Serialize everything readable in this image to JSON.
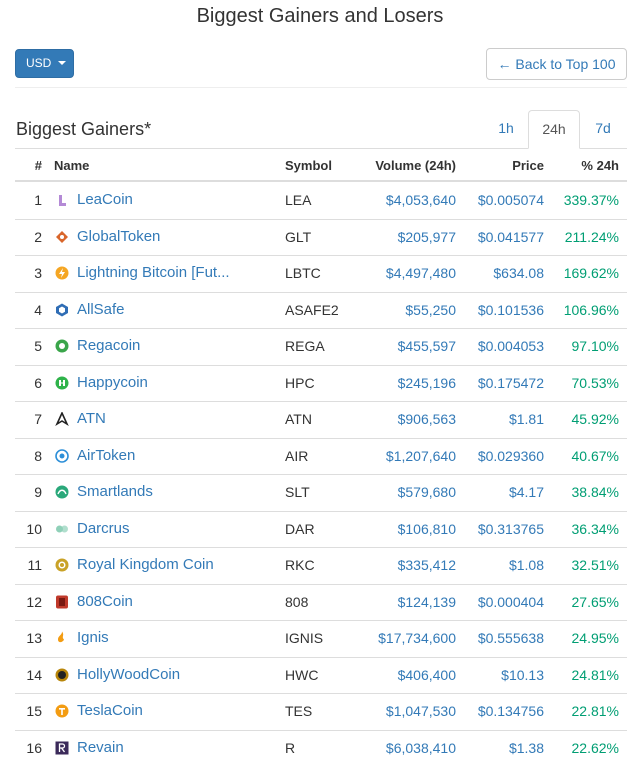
{
  "page": {
    "title": "Biggest Gainers and Losers"
  },
  "toolbar": {
    "currency_label": "USD",
    "back_label": "← Back to Top 100"
  },
  "section": {
    "title": "Biggest Gainers*"
  },
  "tabs": [
    {
      "label": "1h"
    },
    {
      "label": "24h",
      "active": true
    },
    {
      "label": "7d"
    }
  ],
  "table": {
    "headers": {
      "rank": "#",
      "name": "Name",
      "symbol": "Symbol",
      "volume": "Volume (24h)",
      "price": "Price",
      "change": "% 24h"
    },
    "rows": [
      {
        "rank": "1",
        "name": "LeaCoin",
        "symbol": "LEA",
        "volume": "$4,053,640",
        "price": "$0.005074",
        "change": "339.37%",
        "icon": "leacoin-icon",
        "color": "#b48ad6"
      },
      {
        "rank": "2",
        "name": "GlobalToken",
        "symbol": "GLT",
        "volume": "$205,977",
        "price": "$0.041577",
        "change": "211.24%",
        "icon": "globaltoken-icon",
        "color": "#d9662b"
      },
      {
        "rank": "3",
        "name": "Lightning Bitcoin [Fut...",
        "symbol": "LBTC",
        "volume": "$4,497,480",
        "price": "$634.08",
        "change": "169.62%",
        "icon": "lightning-bitcoin-icon",
        "color": "#f5a623"
      },
      {
        "rank": "4",
        "name": "AllSafe",
        "symbol": "ASAFE2",
        "volume": "$55,250",
        "price": "$0.101536",
        "change": "106.96%",
        "icon": "allsafe-icon",
        "color": "#2f6db5"
      },
      {
        "rank": "5",
        "name": "Regacoin",
        "symbol": "REGA",
        "volume": "$455,597",
        "price": "$0.004053",
        "change": "97.10%",
        "icon": "regacoin-icon",
        "color": "#3aa54a"
      },
      {
        "rank": "6",
        "name": "Happycoin",
        "symbol": "HPC",
        "volume": "$245,196",
        "price": "$0.175472",
        "change": "70.53%",
        "icon": "happycoin-icon",
        "color": "#2fb34a"
      },
      {
        "rank": "7",
        "name": "ATN",
        "symbol": "ATN",
        "volume": "$906,563",
        "price": "$1.81",
        "change": "45.92%",
        "icon": "atn-icon",
        "color": "#222222"
      },
      {
        "rank": "8",
        "name": "AirToken",
        "symbol": "AIR",
        "volume": "$1,207,640",
        "price": "$0.029360",
        "change": "40.67%",
        "icon": "airtoken-icon",
        "color": "#2d8fd8"
      },
      {
        "rank": "9",
        "name": "Smartlands",
        "symbol": "SLT",
        "volume": "$579,680",
        "price": "$4.17",
        "change": "38.84%",
        "icon": "smartlands-icon",
        "color": "#2aa87a"
      },
      {
        "rank": "10",
        "name": "Darcrus",
        "symbol": "DAR",
        "volume": "$106,810",
        "price": "$0.313765",
        "change": "36.34%",
        "icon": "darcrus-icon",
        "color": "#8fd0b8"
      },
      {
        "rank": "11",
        "name": "Royal Kingdom Coin",
        "symbol": "RKC",
        "volume": "$335,412",
        "price": "$1.08",
        "change": "32.51%",
        "icon": "royal-kingdom-coin-icon",
        "color": "#c9a227"
      },
      {
        "rank": "12",
        "name": "808Coin",
        "symbol": "808",
        "volume": "$124,139",
        "price": "$0.000404",
        "change": "27.65%",
        "icon": "808coin-icon",
        "color": "#c0392b"
      },
      {
        "rank": "13",
        "name": "Ignis",
        "symbol": "IGNIS",
        "volume": "$17,734,600",
        "price": "$0.555638",
        "change": "24.95%",
        "icon": "ignis-icon",
        "color": "#f39c12"
      },
      {
        "rank": "14",
        "name": "HollyWoodCoin",
        "symbol": "HWC",
        "volume": "$406,400",
        "price": "$10.13",
        "change": "24.81%",
        "icon": "hollywoodcoin-icon",
        "color": "#b8860b"
      },
      {
        "rank": "15",
        "name": "TeslaCoin",
        "symbol": "TES",
        "volume": "$1,047,530",
        "price": "$0.134756",
        "change": "22.81%",
        "icon": "teslacoin-icon",
        "color": "#f39c12"
      },
      {
        "rank": "16",
        "name": "Revain",
        "symbol": "R",
        "volume": "$6,038,410",
        "price": "$1.38",
        "change": "22.62%",
        "icon": "revain-icon",
        "color": "#3b2a5a"
      }
    ]
  },
  "colors": {
    "link": "#337ab7",
    "positive": "#009e73",
    "primary_button": "#337ab7"
  }
}
